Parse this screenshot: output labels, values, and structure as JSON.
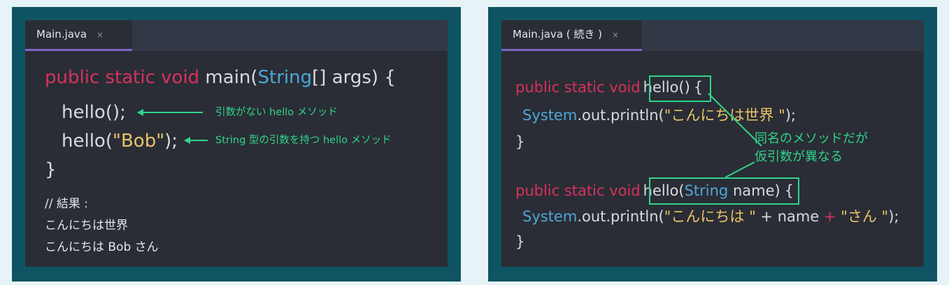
{
  "left": {
    "tab_label": "Main.java",
    "close_glyph": "×",
    "line1": {
      "kw": "public static void",
      "name": " main(",
      "type": "String",
      "rest": "[] args) {"
    },
    "line2": {
      "code": "hello();"
    },
    "line3": {
      "pre": "hello(",
      "str": "\"Bob\"",
      "post": ");"
    },
    "line4": "}",
    "note1": "引数がない hello メソッド",
    "note2": "String 型の引数を持つ hello メソッド",
    "result_header": "// 結果 :",
    "result_line1": "こんにちは世界",
    "result_line2": "こんにちは Bob さん"
  },
  "right": {
    "tab_label": "Main.java ( 続き )",
    "close_glyph": "×",
    "m1_kw": "public static void",
    "m1_name": "hello()",
    "m1_brace": "{",
    "m1_body_type": "System",
    "m1_body_rest": ".out.println(",
    "m1_body_str": "\"こんにちは世界 \"",
    "m1_body_end": ");",
    "m1_close": "}",
    "m2_kw": "public static void",
    "m2_name_pre": "hello(",
    "m2_name_type": "String",
    "m2_name_post": " name)",
    "m2_brace": "{",
    "m2_body_type": "System",
    "m2_body_rest": ".out.println(",
    "m2_body_str1": "\"こんにちは \"",
    "m2_body_plus1": " + ",
    "m2_body_var": "name",
    "m2_body_plus2": " + ",
    "m2_body_str2": "\"さん \"",
    "m2_body_end": ");",
    "m2_close": "}",
    "callout_line1": "同名のメソッドだが",
    "callout_line2": "仮引数が異なる"
  },
  "colors": {
    "keyword": "#d8315f",
    "type": "#4ea7d6",
    "string": "#e8c468",
    "annotation": "#2fd48b",
    "panel": "#0f5463",
    "editor_bg": "#2a2d35",
    "tab_underline": "#7e66c8"
  }
}
